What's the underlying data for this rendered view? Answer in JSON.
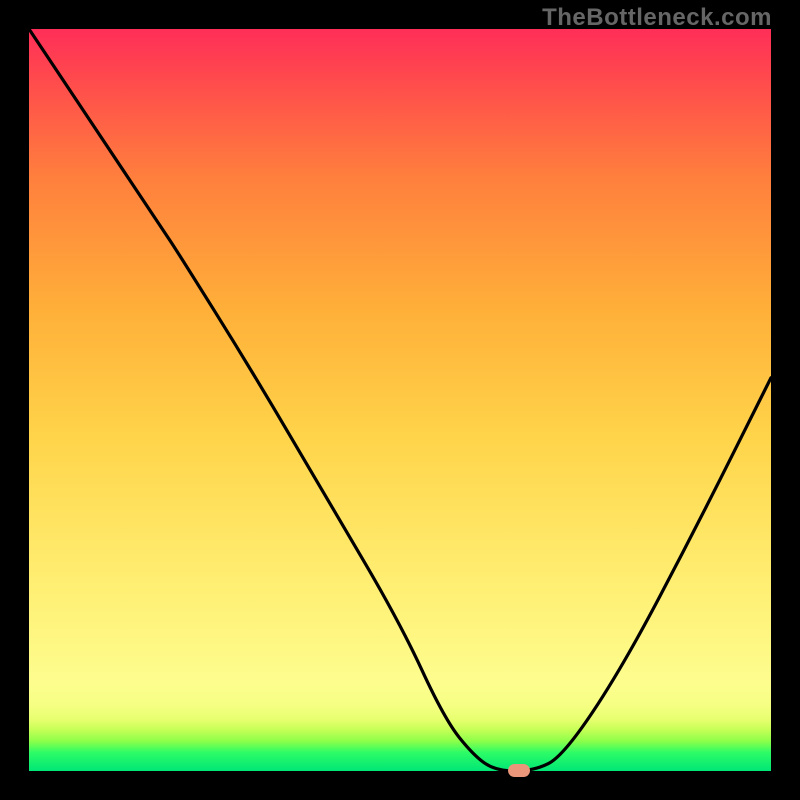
{
  "brand": "TheBottleneck.com",
  "marker": {
    "color": "#e9967a"
  },
  "chart_data": {
    "type": "line",
    "title": "",
    "xlabel": "",
    "ylabel": "",
    "xlim": [
      0,
      100
    ],
    "ylim": [
      0,
      100
    ],
    "x": [
      0,
      8,
      18,
      20,
      30,
      40,
      50,
      56,
      60,
      63,
      68,
      72,
      80,
      90,
      100
    ],
    "values": [
      100,
      88,
      73,
      70,
      54,
      37,
      20,
      7,
      2,
      0,
      0,
      2,
      14,
      33,
      53
    ],
    "marker_point": {
      "x": 66,
      "y": 0
    },
    "gradient_stops": [
      {
        "pct": 0,
        "color": "#00e676"
      },
      {
        "pct": 5,
        "color": "#8cff4a"
      },
      {
        "pct": 12,
        "color": "#fdfd8e"
      },
      {
        "pct": 45,
        "color": "#ffd44a"
      },
      {
        "pct": 80,
        "color": "#ff7f3d"
      },
      {
        "pct": 100,
        "color": "#ff2e58"
      }
    ]
  }
}
